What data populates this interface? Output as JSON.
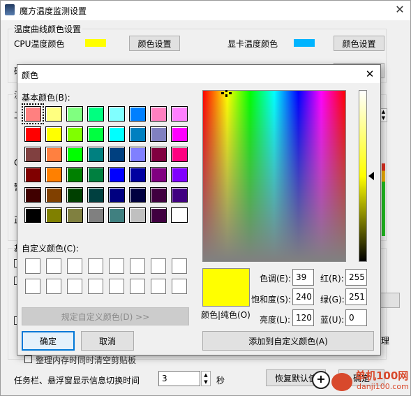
{
  "main": {
    "title": "魔方温度监测设置",
    "section1_title": "温度曲线颜色设置",
    "cpu_color_label": "CPU温度颜色",
    "cpu_color_value": "#ffff00",
    "cpu_color_btn": "颜色设置",
    "gpu_color_label": "显卡温度颜色",
    "gpu_color_value": "#00b4ff",
    "gpu_color_btn": "颜色设置",
    "partial_row_char": "硬",
    "partial_sec2_char": "温",
    "partial_left_chars": [
      "工",
      "C",
      "警",
      "正",
      "基"
    ],
    "partial_right_text": "理",
    "partial_bottom_text": "整理内存时同时清空剪贴板",
    "interval_label": "任务栏、悬浮窗显示信息切换时间",
    "interval_value": "3",
    "interval_unit": "秒",
    "restore_btn": "恢复默认值",
    "ok_btn_partial": "确定",
    "watermark": "danji100.com",
    "watermark_logo": "单机100网"
  },
  "dialog": {
    "title": "颜色",
    "basic_colors_label": "基本颜色(B):",
    "basic_colors": [
      "#ff8080",
      "#ffff80",
      "#80ff80",
      "#00ff80",
      "#80ffff",
      "#0080ff",
      "#ff80c0",
      "#ff80ff",
      "#ff0000",
      "#ffff00",
      "#80ff00",
      "#00ff40",
      "#00ffff",
      "#0080c0",
      "#8080c0",
      "#ff00ff",
      "#804040",
      "#ff8040",
      "#00ff00",
      "#008080",
      "#004080",
      "#8080ff",
      "#800040",
      "#ff0080",
      "#800000",
      "#ff8000",
      "#008000",
      "#008040",
      "#0000ff",
      "#0000a0",
      "#800080",
      "#8000ff",
      "#400000",
      "#804000",
      "#004000",
      "#004040",
      "#000080",
      "#000040",
      "#400040",
      "#400080",
      "#000000",
      "#808000",
      "#808040",
      "#808080",
      "#408080",
      "#c0c0c0",
      "#400040",
      "#ffffff"
    ],
    "custom_colors_label": "自定义颜色(C):",
    "define_custom_btn": "规定自定义颜色(D) >>",
    "ok_btn": "确定",
    "cancel_btn": "取消",
    "preview_color": "#ffff00",
    "preview_label": "颜色|纯色(O)",
    "hue_label": "色调(E):",
    "hue_value": "39",
    "sat_label": "饱和度(S):",
    "sat_value": "240",
    "lum_label": "亮度(L):",
    "lum_value": "120",
    "red_label": "红(R):",
    "red_value": "255",
    "green_label": "绿(G):",
    "green_value": "251",
    "blue_label": "蓝(U):",
    "blue_value": "0",
    "add_custom_btn": "添加到自定义颜色(A)"
  }
}
